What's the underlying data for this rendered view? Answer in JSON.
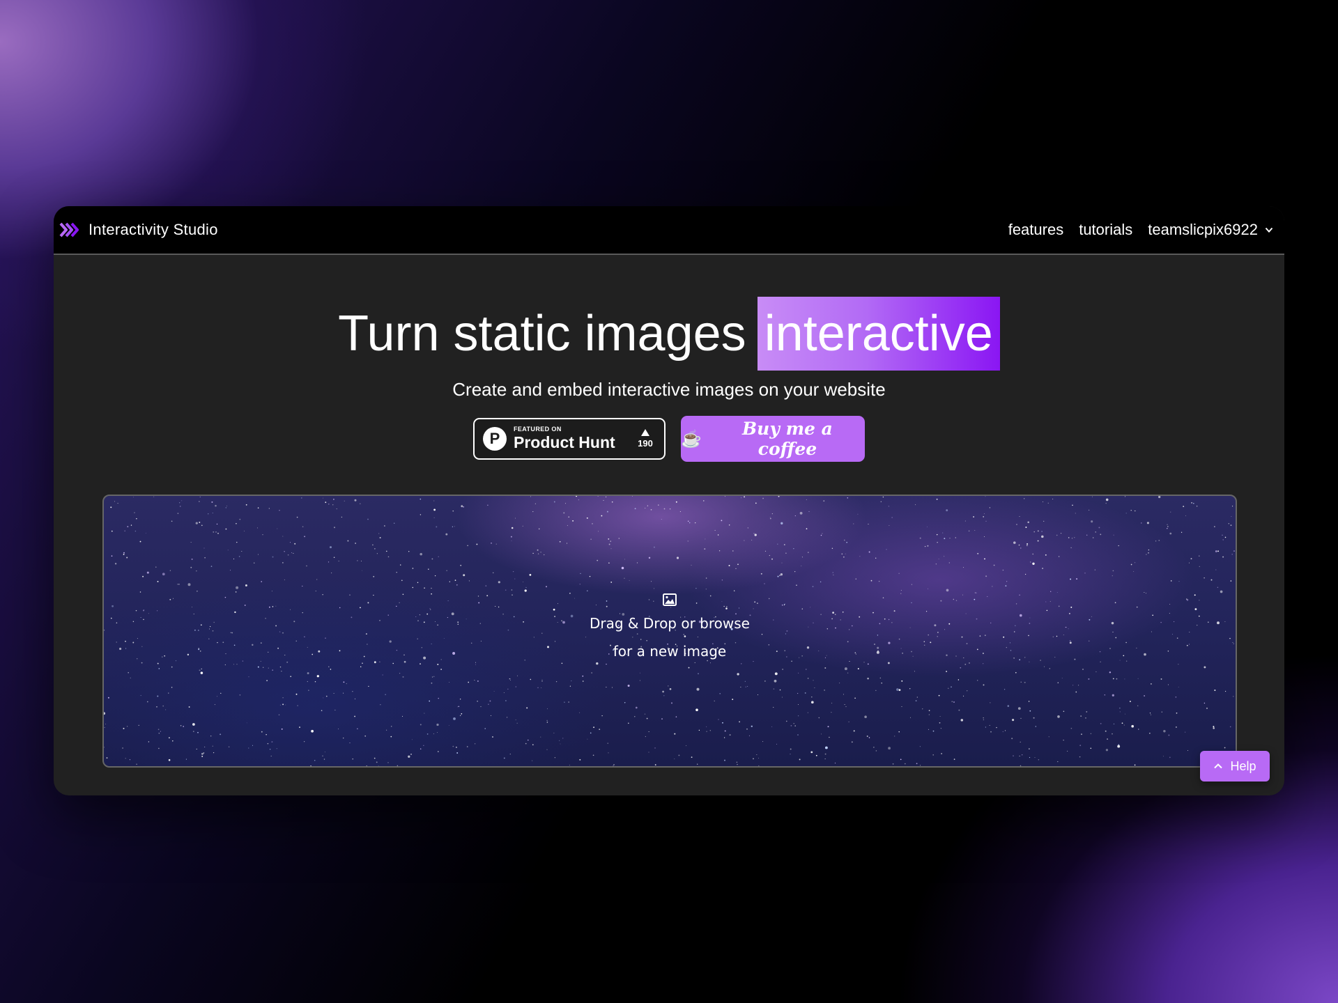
{
  "app": {
    "brand_name": "Interactivity Studio"
  },
  "nav": {
    "links": [
      "features",
      "tutorials"
    ],
    "username": "teamslicpix6922"
  },
  "hero": {
    "headline_prefix": "Turn static images",
    "headline_highlight": "interactive",
    "subtitle": "Create and embed interactive images on your website"
  },
  "product_hunt": {
    "small_label": "FEATURED ON",
    "big_label": "Product Hunt",
    "logo_letter": "P",
    "votes": "190"
  },
  "coffee": {
    "label": "Buy me a coffee",
    "icon": "☕"
  },
  "dropzone": {
    "line1": "Drag & Drop or browse",
    "line2": "for a new image"
  },
  "help": {
    "label": "Help"
  },
  "colors": {
    "accent": "#b86af5",
    "accent_dark": "#8a16f3",
    "window_bg": "#212121",
    "navbar_bg": "#000000"
  }
}
